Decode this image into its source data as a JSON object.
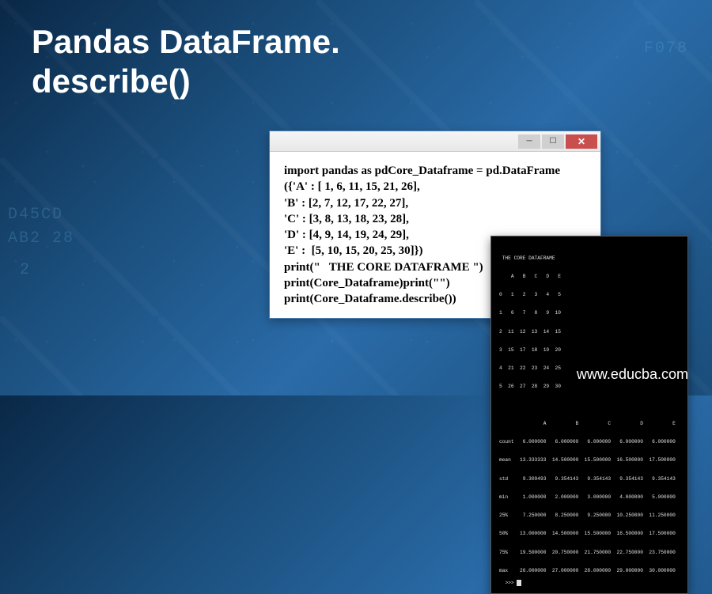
{
  "title_line1": "Pandas DataFrame.",
  "title_line2": "describe()",
  "code_window": {
    "content": "import pandas as pdCore_Dataframe = pd.DataFrame\n({'A' : [ 1, 6, 11, 15, 21, 26],\n'B' : [2, 7, 12, 17, 22, 27],\n'C' : [3, 8, 13, 18, 23, 28],\n'D' : [4, 9, 14, 19, 24, 29],\n'E' :  [5, 10, 15, 20, 25, 30]})\nprint(\"   THE CORE DATAFRAME \")\nprint(Core_Dataframe)print(\"\")\nprint(Core_Dataframe.describe())"
  },
  "output_window": {
    "header": " THE CORE DATAFRAME",
    "table_header": "    A   B   C   D   E",
    "rows": [
      "0   1   2   3   4   5",
      "1   6   7   8   9  10",
      "2  11  12  13  14  15",
      "3  15  17  18  19  20",
      "4  21  22  23  24  25",
      "5  26  27  28  29  30"
    ],
    "describe_header": "               A          B          C          D          E",
    "describe_rows": [
      "count   6.000000   6.000000   6.000000   6.000000   6.000000",
      "mean   13.333333  14.500000  15.500000  16.500000  17.500000",
      "std     9.309493   9.354143   9.354143   9.354143   9.354143",
      "min     1.000000   2.000000   3.000000   4.000000   5.000000",
      "25%     7.250000   8.250000   9.250000  10.250000  11.250000",
      "50%    13.000000  14.500000  15.500000  16.500000  17.500000",
      "75%    19.500000  20.750000  21.750000  22.750000  23.750000",
      "max    26.000000  27.000000  28.000000  29.000000  30.000000"
    ],
    "prompt": ">>> "
  },
  "website": "www.educba.com",
  "colors": {
    "bg_dark": "#0a2847",
    "bg_light": "#2a6ba8",
    "close_red": "#c94f4f"
  }
}
